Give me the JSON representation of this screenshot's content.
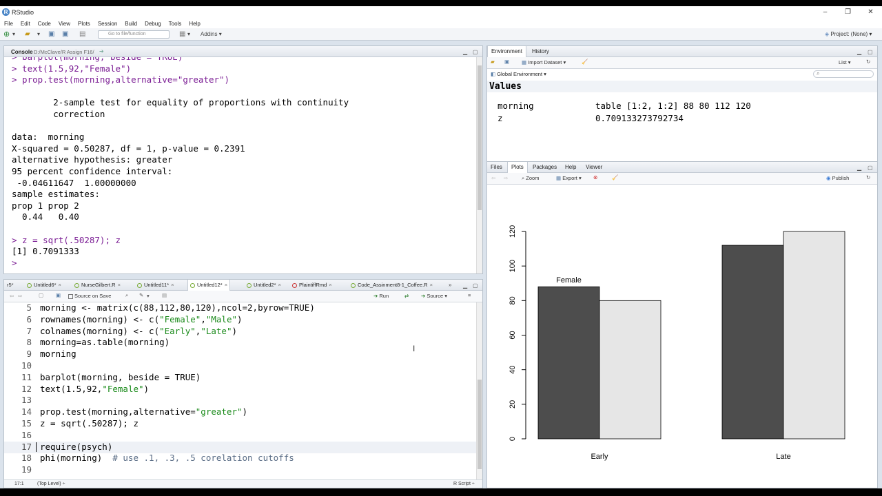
{
  "window": {
    "title": "RStudio",
    "min": "–",
    "max": "❐",
    "close": "✕"
  },
  "menu": [
    "File",
    "Edit",
    "Code",
    "View",
    "Plots",
    "Session",
    "Build",
    "Debug",
    "Tools",
    "Help"
  ],
  "toolbar": {
    "goto_placeholder": "Go to file/function",
    "addins": "Addins",
    "project": "Project: (None)"
  },
  "console": {
    "label": "Console",
    "path": "D:/McClave/R Assign F16/",
    "lines": [
      {
        "t": "> barplot(morning, beside = TRUE)",
        "c": "cmd"
      },
      {
        "t": "> text(1.5,92,\"Female\")",
        "c": "cmd"
      },
      {
        "t": "> prop.test(morning,alternative=\"greater\")",
        "c": "cmd"
      },
      {
        "t": "",
        "c": ""
      },
      {
        "t": "        2-sample test for equality of proportions with continuity",
        "c": ""
      },
      {
        "t": "        correction",
        "c": ""
      },
      {
        "t": "",
        "c": ""
      },
      {
        "t": "data:  morning",
        "c": ""
      },
      {
        "t": "X-squared = 0.50287, df = 1, p-value = 0.2391",
        "c": ""
      },
      {
        "t": "alternative hypothesis: greater",
        "c": ""
      },
      {
        "t": "95 percent confidence interval:",
        "c": ""
      },
      {
        "t": " -0.04611647  1.00000000",
        "c": ""
      },
      {
        "t": "sample estimates:",
        "c": ""
      },
      {
        "t": "prop 1 prop 2",
        "c": ""
      },
      {
        "t": "  0.44   0.40",
        "c": ""
      },
      {
        "t": "",
        "c": ""
      },
      {
        "t": "> z = sqrt(.50287); z",
        "c": "cmd"
      },
      {
        "t": "[1] 0.7091333",
        "c": ""
      },
      {
        "t": "> ",
        "c": "cmd"
      }
    ]
  },
  "editor": {
    "tabs": [
      "Untitled6*",
      "NurseGilbert.R",
      "Untitled11*",
      "Untitled12*",
      "Untitled2*",
      "PlaintiffRmd",
      "Code_Assinment8-1_Coffee.R"
    ],
    "partial_tab": "r5*",
    "source_on_save": "Source on Save",
    "run": "Run",
    "source": "Source",
    "line_numbers": [
      "5",
      "6",
      "7",
      "8",
      "9",
      "10",
      "11",
      "12",
      "13",
      "14",
      "15",
      "16",
      "17",
      "18",
      "19"
    ],
    "code": [
      "morning <- matrix(c(88,112,80,120),ncol=2,byrow=TRUE)",
      "rownames(morning) <- c(\"Female\",\"Male\")",
      "colnames(morning) <- c(\"Early\",\"Late\")",
      "morning=as.table(morning)",
      "morning",
      "",
      "barplot(morning, beside = TRUE)",
      "text(1.5,92,\"Female\")",
      "",
      "prop.test(morning,alternative=\"greater\")",
      "z = sqrt(.50287); z",
      "",
      "require(psych)",
      "phi(morning)  # use .1, .3, .5 corelation cutoffs",
      ""
    ],
    "status_pos": "17:1",
    "status_scope": "(Top Level) ÷",
    "status_type": "R Script ÷"
  },
  "environment": {
    "tabs": [
      "Environment",
      "History"
    ],
    "import": "Import Dataset",
    "list": "List",
    "scope": "Global Environment",
    "section": "Values",
    "rows": [
      {
        "name": "morning",
        "value": "table [1:2, 1:2] 88 80 112 120"
      },
      {
        "name": "z",
        "value": "0.709133273792734"
      }
    ]
  },
  "plots": {
    "tabs": [
      "Files",
      "Plots",
      "Packages",
      "Help",
      "Viewer"
    ],
    "zoom": "Zoom",
    "export": "Export",
    "publish": "Publish"
  },
  "chart_data": {
    "type": "bar",
    "categories": [
      "Early",
      "Late"
    ],
    "series": [
      {
        "values": [
          88,
          112
        ],
        "color": "#4d4d4d"
      },
      {
        "values": [
          80,
          120
        ],
        "color": "#e6e6e6"
      }
    ],
    "ylim": [
      0,
      120
    ],
    "yticks": [
      0,
      20,
      40,
      60,
      80,
      100,
      120
    ],
    "annotations": [
      {
        "text": "Female",
        "x": 1.5,
        "y": 92
      }
    ],
    "title": "",
    "xlabel": "",
    "ylabel": ""
  }
}
